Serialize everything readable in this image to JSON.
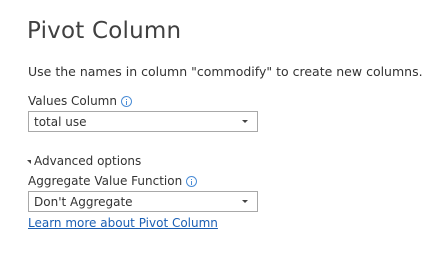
{
  "dialog": {
    "title": "Pivot Column",
    "description": "Use the names in column \"commodify\" to create new columns.",
    "values_column": {
      "label": "Values Column",
      "selected": "total use"
    },
    "advanced_options": {
      "label": "Advanced options",
      "expanded": true
    },
    "aggregate_function": {
      "label": "Aggregate Value Function",
      "selected": "Don't Aggregate"
    },
    "learn_more_link": "Learn more about Pivot Column"
  },
  "icons": {
    "info": "info-icon",
    "dropdown": "chevron-down-icon",
    "expand": "triangle-down-icon"
  },
  "colors": {
    "link": "#1a5fb4",
    "info_icon": "#4a8cd6",
    "input_border": "#a8a8a8"
  }
}
